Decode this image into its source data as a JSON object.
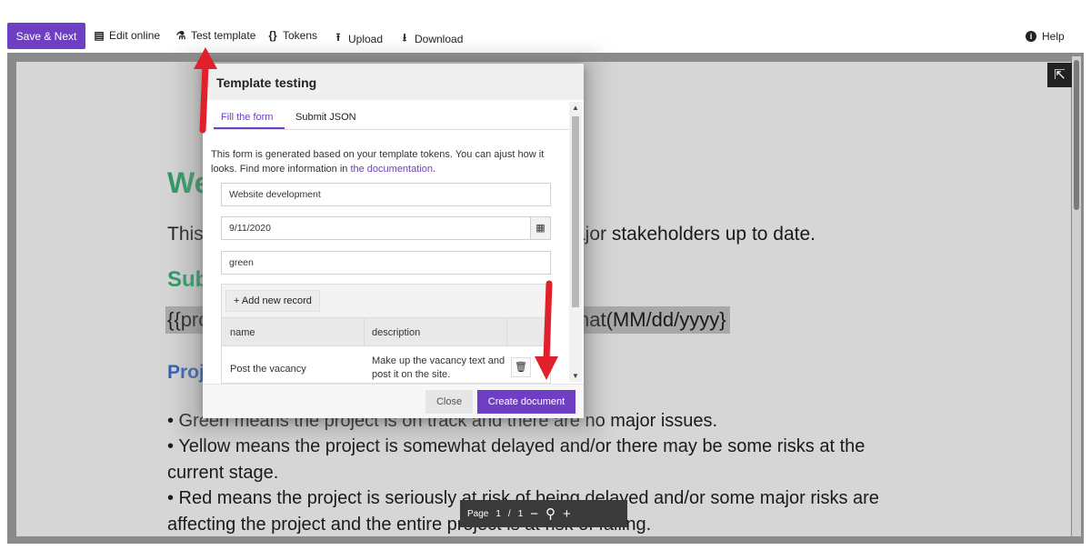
{
  "toolbar": {
    "save_next_label": "Save & Next",
    "edit_online_label": "Edit online",
    "test_template_label": "Test template",
    "tokens_label": "Tokens",
    "upload_label": "Upload",
    "download_label": "Download",
    "help_label": "Help"
  },
  "document": {
    "heading_fragment": "We",
    "paragraph_left": "This",
    "paragraph_right": "ajor stakeholders up to date.",
    "subheading_fragment": "Sub",
    "token_left": "{{pro",
    "token_right": "nat(MM/dd/yyyy}",
    "section_fragment": "Proj",
    "bullets": [
      "•  Green means the project is on track and there are no major issues.",
      "•  Yellow means the project is somewhat delayed and/or there may be some risks at the",
      "current stage.",
      "•  Red means the project is seriously at risk of being delayed and/or some major risks are",
      "affecting the project and the entire project is at risk of failing."
    ]
  },
  "page_bar": {
    "page_label": "Page",
    "current_page": "1",
    "separator": "/",
    "total_pages": "1"
  },
  "modal": {
    "title": "Template testing",
    "tabs": [
      {
        "label": "Fill the form",
        "active": true
      },
      {
        "label": "Submit JSON",
        "active": false
      }
    ],
    "description_text": "This form is generated based on your template tokens. You can ajust how it looks. Find more information in ",
    "description_link": "the documentation",
    "description_end": ".",
    "fields": {
      "project_name": "Website development",
      "date": "9/11/2020",
      "status": "green"
    },
    "records": {
      "add_label": "+  Add new record",
      "columns": [
        "name",
        "description"
      ],
      "rows": [
        {
          "name": "Post the vacancy",
          "description_line1": "Make up the vacancy text and",
          "description_line2": "post it on the site."
        }
      ]
    },
    "close_label": "Close",
    "create_label": "Create document"
  },
  "icons": {
    "edit_online": "document-icon",
    "test_template": "flask-icon",
    "tokens": "braces-icon",
    "upload": "upload-icon",
    "download": "download-icon",
    "help": "info-icon",
    "open_external": "external-link-icon",
    "calendar": "calendar-icon",
    "trash": "trash-icon"
  },
  "colors": {
    "accent": "#6f3fc3",
    "heading_green": "#2a9a62",
    "heading_blue": "#3060b8",
    "arrow_red": "#e0202a"
  }
}
